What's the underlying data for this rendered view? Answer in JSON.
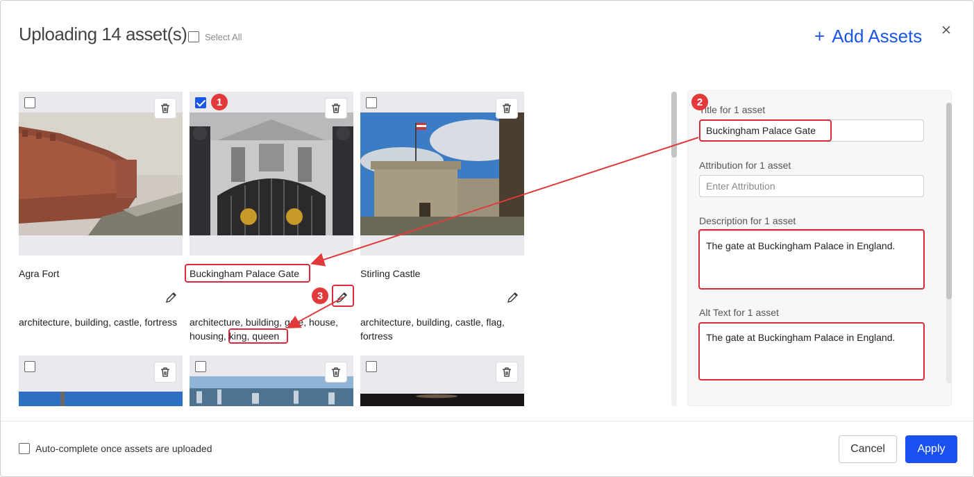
{
  "header": {
    "title": "Uploading 14 asset(s)",
    "select_all_label": "Select All",
    "add_assets_label": "Add Assets",
    "add_icon": "plus-icon",
    "close_icon": "close-icon"
  },
  "assets": [
    {
      "title": "Agra Fort",
      "tags": "architecture, building, castle, fortress",
      "checked": false
    },
    {
      "title": "Buckingham Palace Gate",
      "tags_main": "architecture, building, gate, house, housing,",
      "tags_highlight": "king, queen",
      "checked": true
    },
    {
      "title": "Stirling Castle",
      "tags": "architecture, building, castle, flag, fortress",
      "checked": false
    },
    {
      "title": "",
      "checked": false
    },
    {
      "title": "",
      "checked": false
    },
    {
      "title": "",
      "checked": false
    }
  ],
  "panel": {
    "title_label": "Title for 1 asset",
    "title_value": "Buckingham Palace Gate",
    "attribution_label": "Attribution for 1 asset",
    "attribution_placeholder": "Enter Attribution",
    "description_label": "Description for 1 asset",
    "description_value": "The gate at Buckingham Palace in England.",
    "alt_label": "Alt Text for 1 asset",
    "alt_value": "The gate at Buckingham Palace in England."
  },
  "annotations": {
    "badge_1": "1",
    "badge_2": "2",
    "badge_3": "3",
    "highlight_color": "#d92b3a"
  },
  "footer": {
    "autocomplete_label": "Auto-complete once assets are uploaded",
    "cancel_label": "Cancel",
    "apply_label": "Apply"
  },
  "colors": {
    "accent": "#1a56e8",
    "apply": "#1a4ff0"
  }
}
